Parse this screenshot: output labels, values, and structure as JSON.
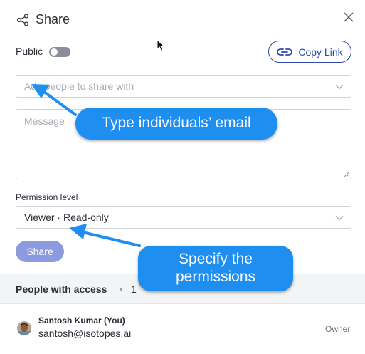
{
  "dialog": {
    "title": "Share",
    "public_label": "Public",
    "public_enabled": false,
    "copy_link_label": "Copy Link"
  },
  "add_people": {
    "placeholder": "Add people to share with"
  },
  "message": {
    "placeholder": "Message"
  },
  "permission": {
    "label": "Permission level",
    "selected": "Viewer · Read-only"
  },
  "share_button_label": "Share",
  "access": {
    "title": "People with access",
    "count": "1",
    "users": [
      {
        "name": "Santosh Kumar (You)",
        "email": "santosh@isotopes.ai",
        "role": "Owner"
      }
    ]
  },
  "annotations": {
    "email_callout": "Type individuals’ email",
    "permission_callout": "Specify the permissions"
  },
  "icons": {
    "share": "share-icon",
    "close": "close-icon",
    "link": "link-icon",
    "chevron": "chevron-down-icon"
  },
  "colors": {
    "accent": "#2f4bb3",
    "share_button": "#8c9be0",
    "callout": "#1f8ef1"
  }
}
